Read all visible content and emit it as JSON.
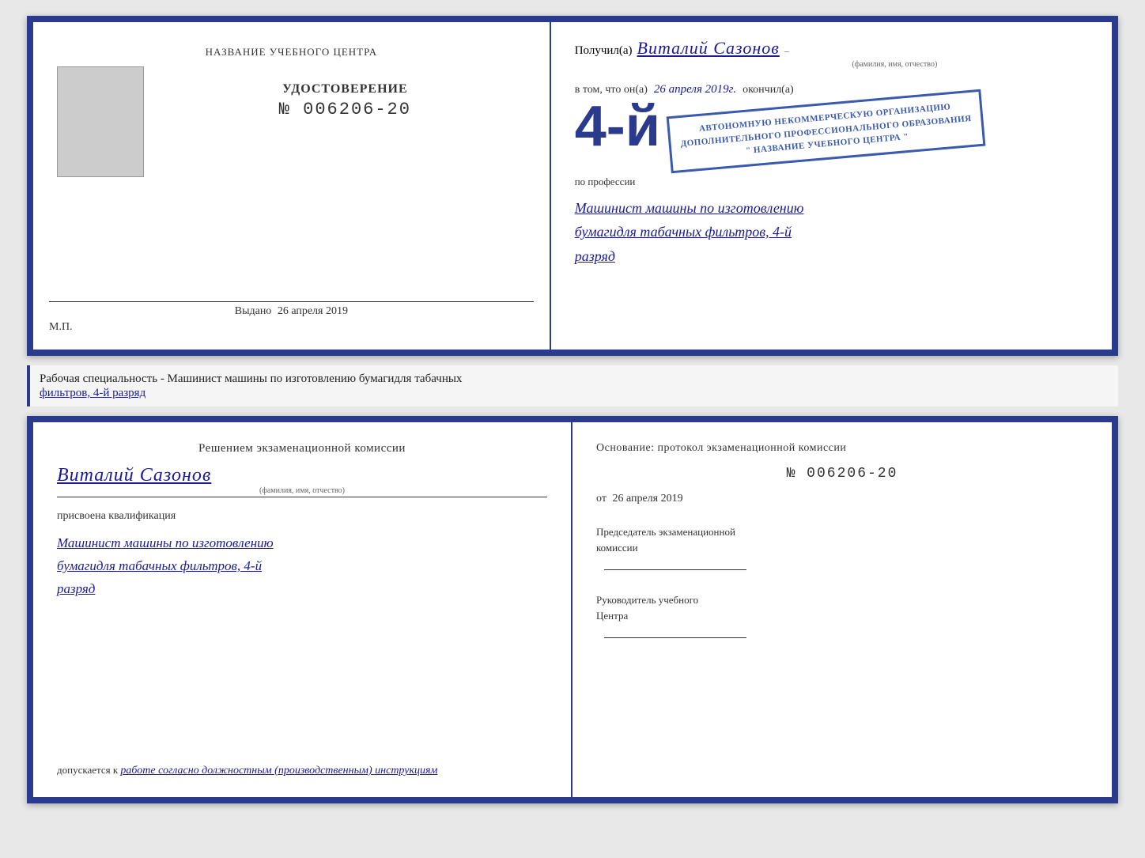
{
  "top_cert": {
    "left": {
      "training_center_label": "НАЗВАНИЕ УЧЕБНОГО ЦЕНТРА",
      "cert_title": "УДОСТОВЕРЕНИЕ",
      "cert_number": "№ 006206-20",
      "issued_label": "Выдано",
      "issued_date": "26 апреля 2019",
      "mp_label": "М.П."
    },
    "right": {
      "received_prefix": "Получил(а)",
      "recipient_name": "Виталий Сазонов",
      "name_sublabel": "(фамилия, имя, отчество)",
      "in_that_prefix": "в том, что он(а)",
      "date_handwritten": "26 апреля 2019г.",
      "finished_label": "окончил(а)",
      "number_large": "4-й",
      "org_line1": "АВТОНОМНУЮ НЕКОММЕРЧЕСКУЮ ОРГАНИЗАЦИЮ",
      "org_line2": "ДОПОЛНИТЕЛЬНОГО ПРОФЕССИОНАЛЬНОГО ОБРАЗОВАНИЯ",
      "org_line3": "\" НАЗВАНИЕ УЧЕБНОГО ЦЕНТРА \"",
      "profession_prefix": "по профессии",
      "profession_line1": "Машинист машины по изготовлению",
      "profession_line2": "бумагидля табачных фильтров, 4-й",
      "profession_line3": "разряд"
    }
  },
  "info_bar": {
    "text_prefix": "Рабочая специальность - Машинист машины по изготовлению бумагидля табачных",
    "text_underline": "фильтров, 4-й разряд"
  },
  "bottom_cert": {
    "left": {
      "decision_text": "Решением  экзаменационной  комиссии",
      "person_name": "Виталий Сазонов",
      "name_sublabel": "(фамилия, имя, отчество)",
      "qualification_assigned": "присвоена квалификация",
      "qualification_line1": "Машинист машины по изготовлению",
      "qualification_line2": "бумагидля табачных фильтров, 4-й",
      "qualification_line3": "разряд",
      "allowed_prefix": "допускается к",
      "allowed_text": "работе согласно должностным (производственным) инструкциям"
    },
    "right": {
      "basis_text": "Основание:  протокол  экзаменационной  комиссии",
      "protocol_number": "№  006206-20",
      "from_label": "от",
      "from_date": "26 апреля 2019",
      "chairman_label_line1": "Председатель экзаменационной",
      "chairman_label_line2": "комиссии",
      "director_label_line1": "Руководитель учебного",
      "director_label_line2": "Центра"
    }
  }
}
